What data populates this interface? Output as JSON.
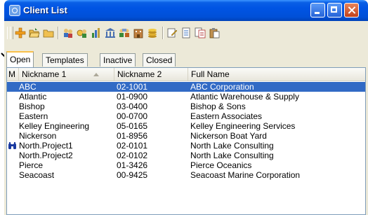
{
  "window": {
    "title": "Client List"
  },
  "colors": {
    "titlebar": "#0054e3",
    "selection": "#316ac5",
    "tab_highlight": "#f9c04a"
  },
  "toolbar": {
    "icons": [
      "add-icon",
      "open-folder-icon",
      "folder-icon",
      "people-icon",
      "key-people-icon",
      "chart-icon",
      "bank-icon",
      "group-icon",
      "building-icon",
      "coins-icon",
      "note-icon",
      "document-icon",
      "multi-document-icon",
      "paste-icon"
    ]
  },
  "tabs": [
    {
      "label": "Open",
      "active": true
    },
    {
      "label": "Templates",
      "active": false
    },
    {
      "label": "Inactive",
      "active": false
    },
    {
      "label": "Closed",
      "active": false
    }
  ],
  "table": {
    "columns": {
      "marker": "M",
      "nickname1": "Nickname 1",
      "nickname2": "Nickname 2",
      "fullname": "Full Name"
    },
    "sort_column": "nickname1",
    "rows": [
      {
        "nick1": "ABC",
        "nick2": "02-1001",
        "full": "ABC Corporation",
        "selected": true,
        "marker": ""
      },
      {
        "nick1": "Atlantic",
        "nick2": "01-0900",
        "full": "Atlantic Warehouse & Supply",
        "marker": ""
      },
      {
        "nick1": "Bishop",
        "nick2": "03-0400",
        "full": "Bishop & Sons",
        "marker": ""
      },
      {
        "nick1": "Eastern",
        "nick2": "00-0700",
        "full": "Eastern Associates",
        "marker": ""
      },
      {
        "nick1": "Kelley Engineering",
        "nick2": "05-0165",
        "full": "Kelley Engineering Services",
        "marker": ""
      },
      {
        "nick1": "Nickerson",
        "nick2": "01-8956",
        "full": "Nickerson Boat Yard",
        "marker": ""
      },
      {
        "nick1": "North.Project1",
        "nick2": "02-0101",
        "full": "North Lake Consulting",
        "marker": "binoculars-icon"
      },
      {
        "nick1": "North.Project2",
        "nick2": "02-0102",
        "full": "North Lake Consulting",
        "marker": ""
      },
      {
        "nick1": "Pierce",
        "nick2": "01-3426",
        "full": "Pierce Oceanics",
        "marker": ""
      },
      {
        "nick1": "Seacoast",
        "nick2": "00-9425",
        "full": "Seacoast Marine Corporation",
        "marker": ""
      }
    ]
  }
}
